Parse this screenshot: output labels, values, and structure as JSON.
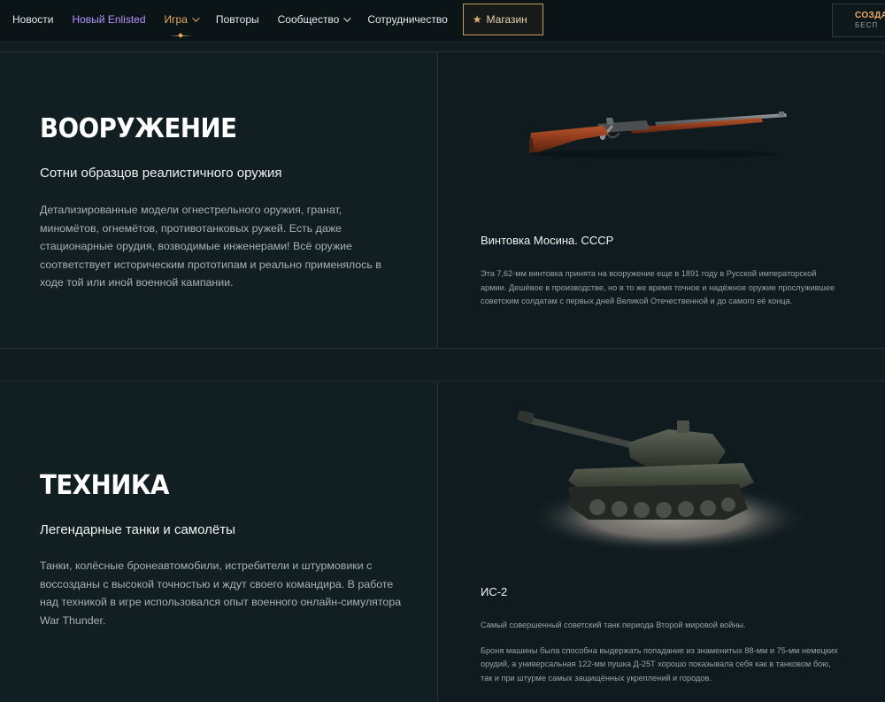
{
  "nav": {
    "items": [
      {
        "label": "Новости"
      },
      {
        "label": "Новый Enlisted"
      },
      {
        "label": "Игра"
      },
      {
        "label": "Повторы"
      },
      {
        "label": "Сообщество"
      },
      {
        "label": "Сотрудничество"
      }
    ],
    "shop_label": "Магазин",
    "create_label": "СОЗДАТ",
    "create_sub": "БЕСП"
  },
  "colors": {
    "accent": "#e8a961",
    "highlight": "#b592ff",
    "background": "#111c1f"
  },
  "sections": [
    {
      "heading": "ВООРУЖЕНИЕ",
      "subtitle": "Сотни образцов реалистичного оружия",
      "description": "Детализированные модели огнестрельного оружия, гранат, миномётов, огнемётов, противотанковых ружей. Есть даже стационарные орудия, возводимые инженерами! Всё оружие соответствует историческим прототипам и реально применялось в ходе той или иной военной кампании.",
      "item_title": "Винтовка Мосина. СССР",
      "item_desc": [
        "Эта 7,62-мм винтовка принята на вооружение еще в 1891 году в Русской императорской армии. Дешёвое в производстве, но в то же время точное и надёжное оружие прослужившее советским солдатам с первых дней Великой Отечественной и до самого её конца."
      ]
    },
    {
      "heading": "ТЕХНИКА",
      "subtitle": "Легендарные танки и самолёты",
      "description": "Танки, колёсные бронеавтомобили, истребители и штурмовики с воссозданы с высокой точностью и ждут своего командира. В работе над техникой в игре использовался опыт военного онлайн-симулятора War Thunder.",
      "item_title": "ИС-2",
      "item_desc": [
        "Самый совершенный советский танк периода Второй мировой войны.",
        "Броня машины была способна выдержать попадание из знаменитых 88-мм и 75-мм немецких орудий, а универсальная 122-мм пушка Д-25Т хорошо показывала себя как в танковом бою, так и при штурме самых защищённых укреплений и городов."
      ]
    }
  ]
}
